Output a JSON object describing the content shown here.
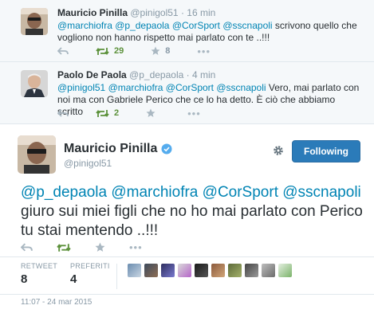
{
  "tweets": [
    {
      "name": "Mauricio Pinilla",
      "handle": "@pinigol51",
      "time": "· 16 min",
      "text_segments": [
        {
          "t": "@marchiofra",
          "link": true
        },
        {
          "t": " ",
          "link": false
        },
        {
          "t": "@p_depaola",
          "link": true
        },
        {
          "t": " ",
          "link": false
        },
        {
          "t": "@CorSport",
          "link": true
        },
        {
          "t": " ",
          "link": false
        },
        {
          "t": "@sscnapoli",
          "link": true
        },
        {
          "t": " scrivono quello che vogliono non hanno rispetto mai parlato con te ..!!!",
          "link": false
        }
      ],
      "retweets": "29",
      "favorites": "8"
    },
    {
      "name": "Paolo De Paola",
      "handle": "@p_depaola",
      "time": "· 4 min",
      "text_segments": [
        {
          "t": "@pinigol51",
          "link": true
        },
        {
          "t": " ",
          "link": false
        },
        {
          "t": "@marchiofra",
          "link": true
        },
        {
          "t": " ",
          "link": false
        },
        {
          "t": "@CorSport",
          "link": true
        },
        {
          "t": " ",
          "link": false
        },
        {
          "t": "@sscnapoli",
          "link": true
        },
        {
          "t": " Vero, mai parlato con noi ma con Gabriele Perico che ce lo ha detto. È ciò che abbiamo scritto",
          "link": false
        }
      ],
      "retweets": "2",
      "favorites": ""
    }
  ],
  "main_tweet": {
    "name": "Mauricio Pinilla",
    "handle": "@pinigol51",
    "follow_label": "Following",
    "text_segments": [
      {
        "t": "@p_depaola",
        "link": true
      },
      {
        "t": " ",
        "link": false
      },
      {
        "t": "@marchiofra",
        "link": true
      },
      {
        "t": " ",
        "link": false
      },
      {
        "t": "@CorSport",
        "link": true
      },
      {
        "t": " ",
        "link": false
      },
      {
        "t": "@sscnapoli",
        "link": true
      },
      {
        "t": " giuro sui miei figli che no ho mai parlato con Perico tu stai mentendo ..!!!",
        "link": false
      }
    ],
    "retweet_label": "RETWEET",
    "retweet_count": "8",
    "favorites_label": "PREFERITI",
    "favorites_count": "4",
    "date": "11:07 - 24 mar 2015"
  },
  "colors": {
    "link": "#0084b4",
    "retweet_green": "#5c913b",
    "follow_blue": "#2b7bb9",
    "verified": "#55acee"
  },
  "icons": [
    "reply-icon",
    "retweet-icon",
    "favorite-star-icon",
    "more-icon",
    "gear-icon",
    "verified-badge-icon"
  ]
}
